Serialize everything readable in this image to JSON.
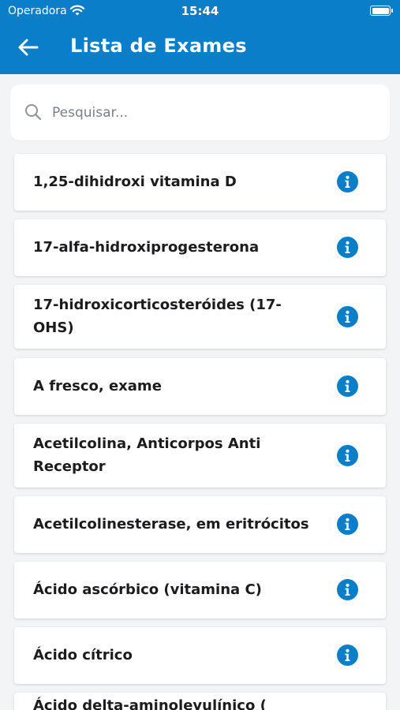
{
  "status_bar": {
    "carrier": "Operadora",
    "time": "15:44"
  },
  "header": {
    "title": "Lista de Exames",
    "back_icon": "arrow-left-icon"
  },
  "search": {
    "placeholder": "Pesquisar...",
    "value": "",
    "icon": "search-icon"
  },
  "exams": [
    {
      "label": "1,25-dihidroxi vitamina D",
      "icon": "info-icon"
    },
    {
      "label": "17-alfa-hidroxiprogesterona",
      "icon": "info-icon"
    },
    {
      "label": "17-hidroxicorticosteróides (17-OHS)",
      "icon": "info-icon"
    },
    {
      "label": "A fresco, exame",
      "icon": "info-icon"
    },
    {
      "label": "Acetilcolina, Anticorpos Anti Receptor",
      "icon": "info-icon"
    },
    {
      "label": "Acetilcolinesterase, em eritrócitos",
      "icon": "info-icon"
    },
    {
      "label": "Ácido ascórbico (vitamina C)",
      "icon": "info-icon"
    },
    {
      "label": "Ácido cítrico",
      "icon": "info-icon"
    },
    {
      "label": "Ácido delta-aminolevulínico (",
      "icon": "info-icon"
    }
  ],
  "colors": {
    "primary": "#0a7ec9",
    "background": "#f2f4f6",
    "card": "#ffffff",
    "text": "#1c1c1e"
  }
}
